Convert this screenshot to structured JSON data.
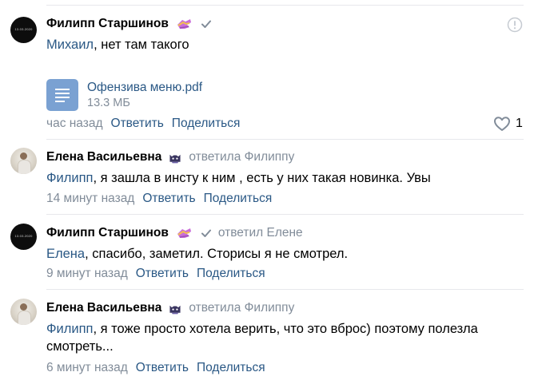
{
  "comments": [
    {
      "author": "Филипп Старшинов",
      "avatar_text": "13.03.2020",
      "mention": "Михаил",
      "text": ", нет там такого",
      "attachment": {
        "name": "Офензива меню.pdf",
        "size": "13.3 МБ"
      },
      "time": "час назад",
      "reply_label": "Ответить",
      "share_label": "Поделиться",
      "likes": "1"
    },
    {
      "author": "Елена Васильевна",
      "reply_to": "ответила Филиппу",
      "mention": "Филипп",
      "text": ", я зашла в инсту к ним , есть у них такая новинка. Увы",
      "time": "14 минут назад",
      "reply_label": "Ответить",
      "share_label": "Поделиться"
    },
    {
      "author": "Филипп Старшинов",
      "avatar_text": "13.03.2020",
      "reply_to": "ответил Елене",
      "mention": "Елена",
      "text": ", спасибо, заметил. Сторисы я не смотрел.",
      "time": "9 минут назад",
      "reply_label": "Ответить",
      "share_label": "Поделиться"
    },
    {
      "author": "Елена Васильевна",
      "reply_to": "ответила Филиппу",
      "mention": "Филипп",
      "text": ", я тоже просто хотела верить, что это вброс) поэтому полезла смотреть...",
      "time": "6 минут назад",
      "reply_label": "Ответить",
      "share_label": "Поделиться"
    }
  ],
  "colors": {
    "link": "#2a5885",
    "muted": "#818c99",
    "doc_icon": "#7aa1d2",
    "separator": "#e7e8ec"
  },
  "icons": [
    "verified-check-icon",
    "report-icon",
    "like-heart-icon",
    "document-icon",
    "hand-emoji-icon",
    "cat-emoji-icon"
  ]
}
